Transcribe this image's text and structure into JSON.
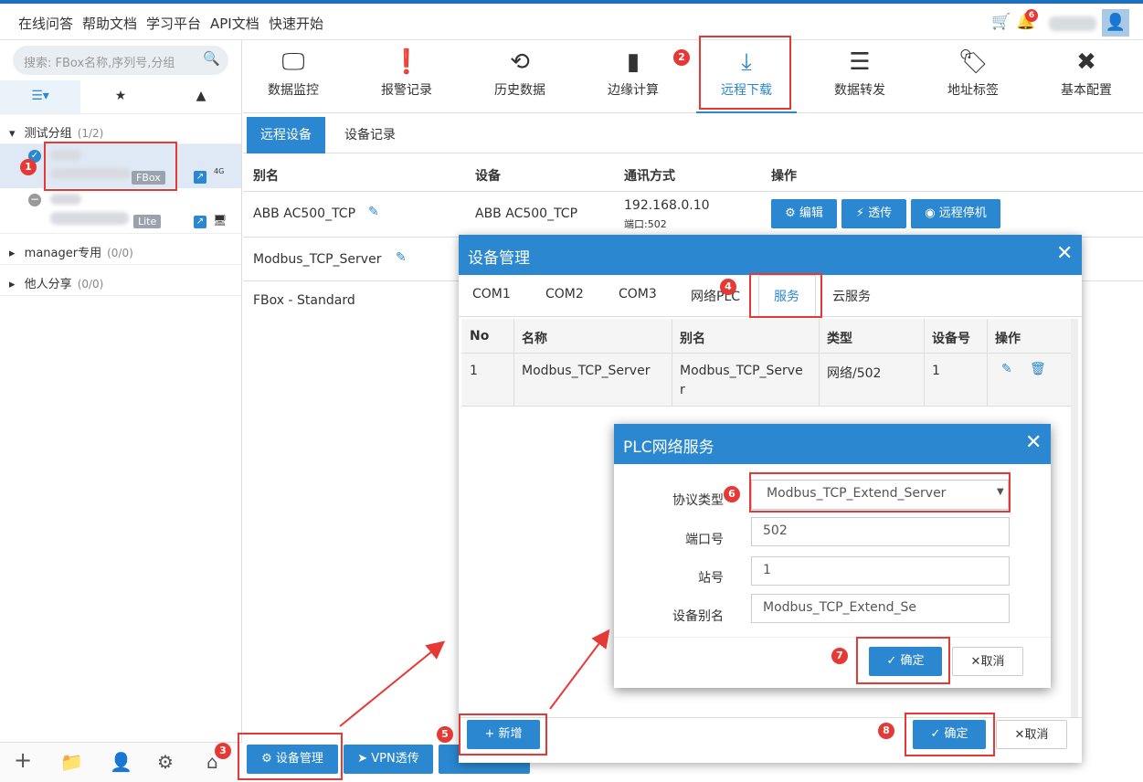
{
  "topnav": {
    "links": [
      "在线问答",
      "帮助文档",
      "学习平台",
      "API文档",
      "快速开始"
    ],
    "notif_count": "6"
  },
  "sidebar": {
    "search_placeholder": "搜索: FBox名称,序列号,分组",
    "groups": [
      {
        "name": "测试分组",
        "count": "(1/2)"
      },
      {
        "name": "manager专用",
        "count": "(0/0)"
      },
      {
        "name": "他人分享",
        "count": "(0/0)"
      }
    ],
    "devices": [
      {
        "tag": "FBox",
        "net": "4G"
      },
      {
        "tag": "Lite"
      }
    ]
  },
  "toolbar": {
    "items": [
      "数据监控",
      "报警记录",
      "历史数据",
      "边缘计算",
      "远程下载",
      "数据转发",
      "地址标签",
      "基本配置"
    ]
  },
  "subtabs": [
    "远程设备",
    "设备记录"
  ],
  "table": {
    "headers": [
      "别名",
      "设备",
      "通讯方式",
      "操作"
    ],
    "rows": [
      {
        "alias": "ABB AC500_TCP",
        "device": "ABB AC500_TCP",
        "comm": "192.168.0.10",
        "port": "端口:502"
      },
      {
        "alias": "Modbus_TCP_Server"
      },
      {
        "alias": "FBox - Standard"
      }
    ],
    "actions": [
      "编辑",
      "透传",
      "远程停机"
    ]
  },
  "bottom_buttons": [
    "设备管理",
    "VPN透传"
  ],
  "modal_device": {
    "title": "设备管理",
    "tabs": [
      "COM1",
      "COM2",
      "COM3",
      "网络PLC",
      "服务",
      "云服务"
    ],
    "headers": [
      "No",
      "名称",
      "别名",
      "类型",
      "设备号",
      "操作"
    ],
    "row": {
      "no": "1",
      "name": "Modbus_TCP_Server",
      "alias_a": "Modbus_TCP_Serve",
      "alias_b": "r",
      "type": "网络/502",
      "dev": "1"
    },
    "add": "新增",
    "ok": "确定",
    "cancel": "取消"
  },
  "modal_plc": {
    "title": "PLC网络服务",
    "labels": [
      "协议类型",
      "端口号",
      "站号",
      "设备别名"
    ],
    "protocol": "Modbus_TCP_Extend_Server",
    "port": "502",
    "station": "1",
    "alias": "Modbus_TCP_Extend_Se",
    "ok": "确定",
    "cancel": "取消"
  },
  "markers": [
    "1",
    "2",
    "3",
    "4",
    "5",
    "6",
    "7",
    "8"
  ]
}
